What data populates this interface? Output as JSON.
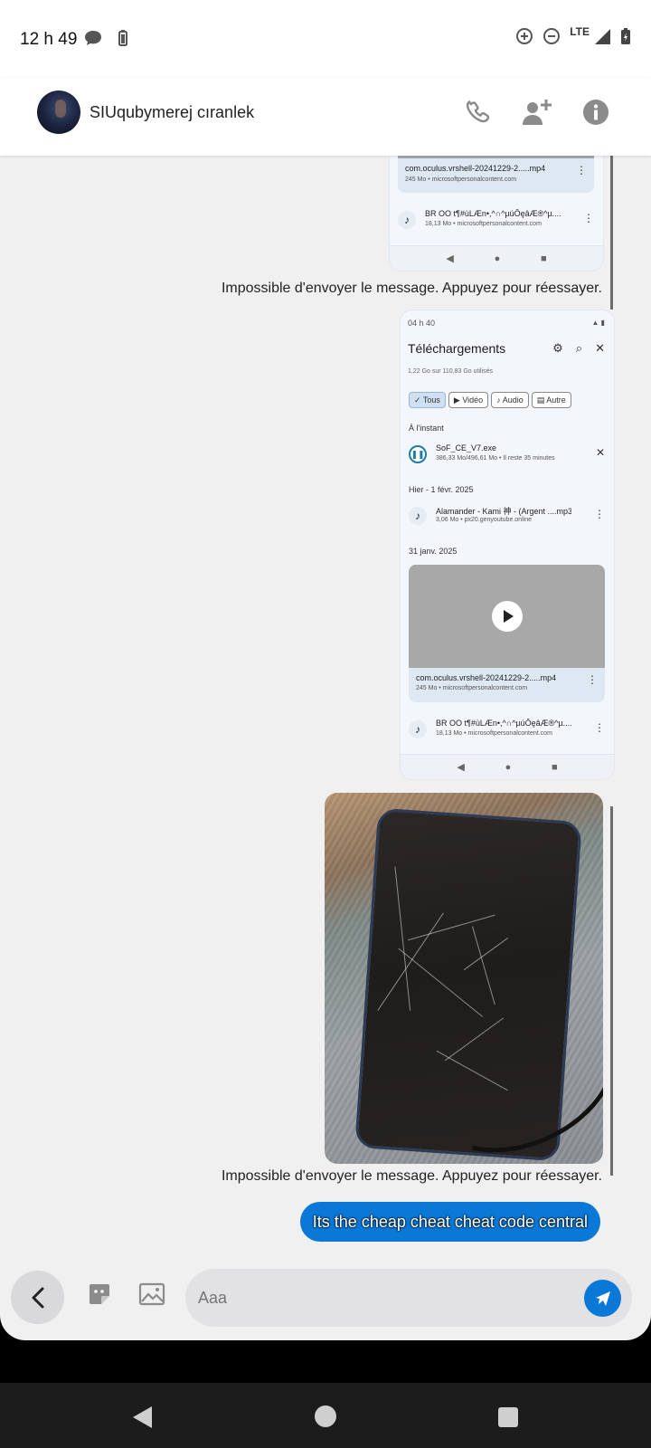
{
  "status_bar": {
    "time": "12 h 49",
    "network": "LTE"
  },
  "header": {
    "contact_name": "SIUqubymerej cıranlek"
  },
  "screenshot_top": {
    "video_title": "com.oculus.vrshell-20241229-2.....mp4",
    "video_sub": "245 Mo • microsoftpersonalcontent.com",
    "audio_title": "BR OO  t¶#ùLÆn•,^∩^µúÔęâÆ®^µ.......",
    "audio_sub": "18,13 Mo • microsoftpersonalcontent.com"
  },
  "screenshot_main": {
    "status_time": "04 h 40",
    "title": "Téléchargements",
    "usage": "1,22 Go sur 110,83 Go utilisés",
    "chips": [
      "Tous",
      "Vidéo",
      "Audio",
      "Autre"
    ],
    "section_now": "À l'instant",
    "dl_title": "SoF_CE_V7.exe",
    "dl_sub": "386,33 Mo/496,61 Mo • Il reste 35 minutes",
    "section_yesterday": "Hier - 1 févr. 2025",
    "track_title": "Alamander - Kami 神 - (Argent ....mp3",
    "track_sub": "3,06 Mo • px20.genyoutube.online",
    "section_date": "31 janv. 2025",
    "video_title": "com.oculus.vrshell-20241229-2.....mp4",
    "video_sub": "245 Mo • microsoftpersonalcontent.com",
    "audio_title": "BR OO  t¶#ùLÆn•,^∩^µúÔęâÆ®^µ.......",
    "audio_sub": "18,13 Mo • microsoftpersonalcontent.com"
  },
  "messages": {
    "failed_1": "Impossible d'envoyer le message. Appuyez pour réessayer.",
    "failed_2": "Impossible d'envoyer le message. Appuyez pour réessayer.",
    "last_text": "Its the cheap cheat cheat code central"
  },
  "composer": {
    "placeholder": "Aaa"
  },
  "colors": {
    "accent": "#0a78d7",
    "background": "#f0f0f1"
  }
}
